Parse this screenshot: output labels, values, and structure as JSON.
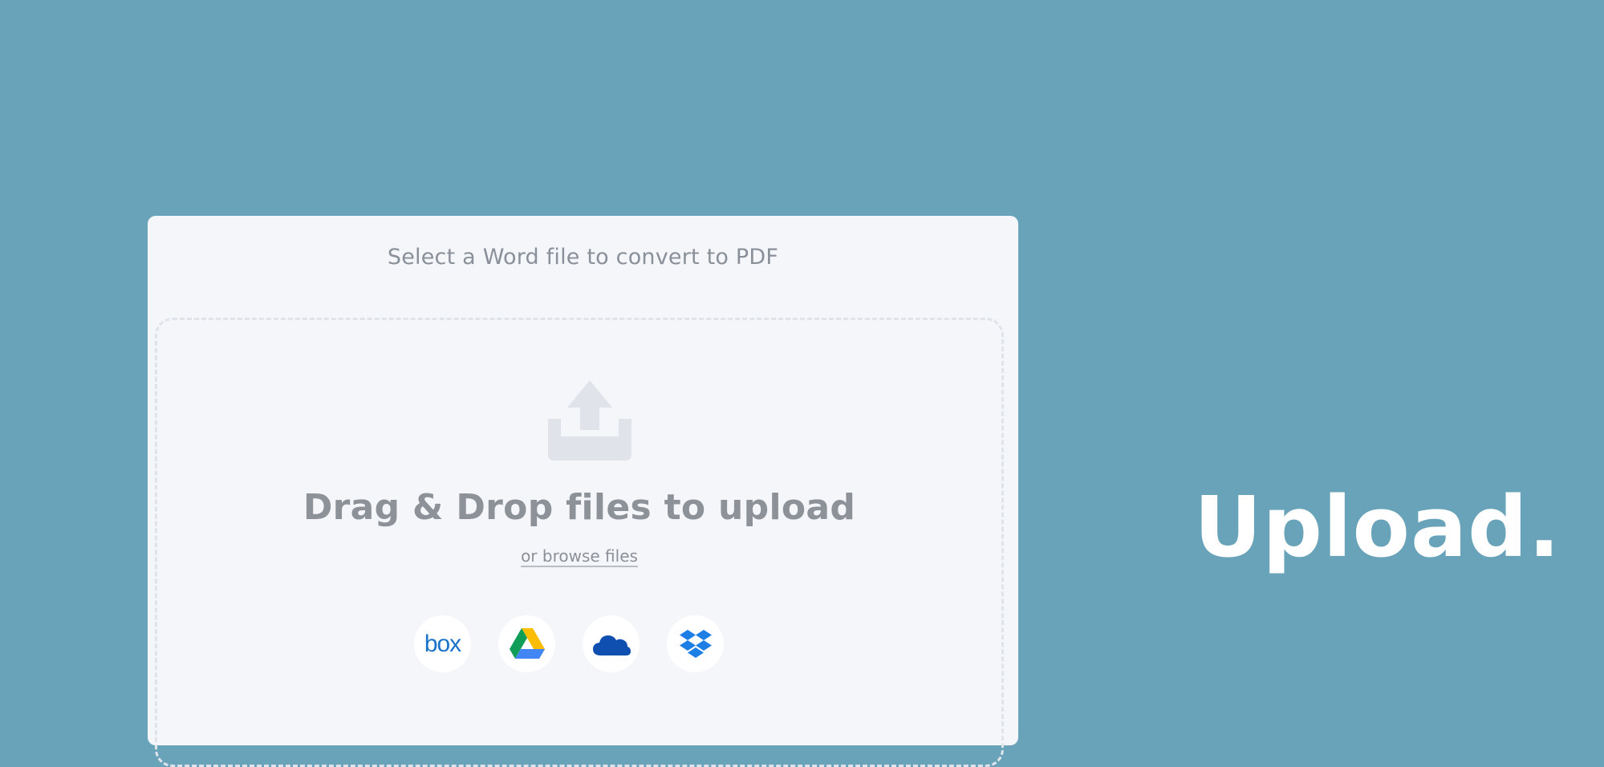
{
  "panel": {
    "title": "Select a Word file to convert to PDF"
  },
  "dropzone": {
    "icon": "upload-tray-icon",
    "heading": "Drag & Drop files to upload",
    "browse_label": "or browse files"
  },
  "services": [
    {
      "name": "box",
      "label": "box",
      "icon": "box-icon",
      "color": "#1a73c9"
    },
    {
      "name": "google-drive",
      "icon": "google-drive-icon"
    },
    {
      "name": "onedrive",
      "icon": "onedrive-icon",
      "color": "#0f4fb0"
    },
    {
      "name": "dropbox",
      "icon": "dropbox-icon",
      "color": "#1d7ee6"
    }
  ],
  "hero": {
    "text": "Upload."
  },
  "colors": {
    "background": "#68a3ba",
    "panel": "#f4f6fa",
    "muted_text": "#8d9299",
    "icon_gray": "#e0e3e9"
  }
}
